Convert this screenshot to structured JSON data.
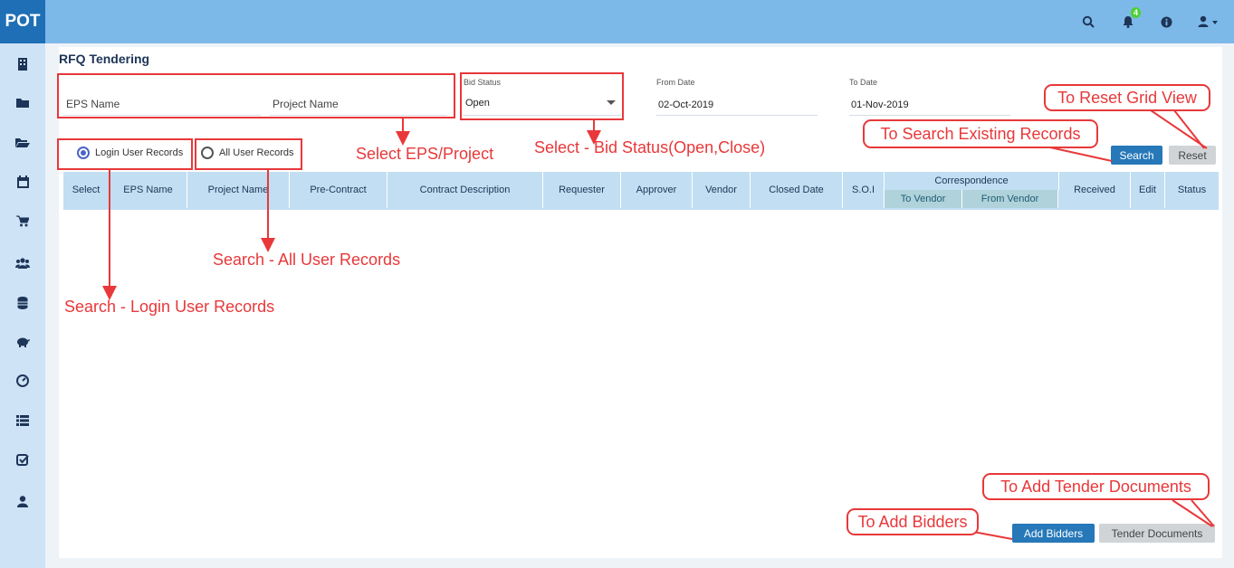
{
  "app": {
    "logo": "POT",
    "notification_count": "4"
  },
  "page": {
    "title": "RFQ Tendering"
  },
  "filters": {
    "eps_name_placeholder": "EPS Name",
    "project_name_placeholder": "Project Name",
    "bid_status_label": "Bid Status",
    "bid_status_value": "Open",
    "from_date_label": "From Date",
    "from_date_value": "02-Oct-2019",
    "to_date_label": "To Date",
    "to_date_value": "01-Nov-2019",
    "radio_login": "Login User Records",
    "radio_all": "All User Records",
    "search_label": "Search",
    "reset_label": "Reset"
  },
  "grid": {
    "headers": [
      "Select",
      "EPS Name",
      "Project Name",
      "Pre-Contract",
      "Contract Description",
      "Requester",
      "Approver",
      "Vendor",
      "Closed Date",
      "S.O.I",
      "Correspondence",
      "Received",
      "Edit",
      "Status"
    ],
    "sub_headers": [
      "To Vendor",
      "From Vendor"
    ]
  },
  "footer": {
    "add_bidders_label": "Add Bidders",
    "tender_documents_label": "Tender Documents"
  },
  "annotations": {
    "select_eps": "Select EPS/Project",
    "select_bid": "Select - Bid Status(Open,Close)",
    "search_all": "Search - All User Records",
    "search_login": "Search - Login User Records",
    "reset_grid": "To Reset Grid View",
    "search_existing": "To Search Existing Records",
    "add_tender_docs": "To Add Tender Documents",
    "add_bidders": "To Add Bidders"
  },
  "colors": {
    "topbar": "#7db9e8",
    "logo_bg": "#1e6fb5",
    "sidebar": "#cfe3f7",
    "primary_button": "#2778b8",
    "annotation": "#e8383a"
  },
  "icons": {
    "top": [
      "search-icon",
      "bell-icon",
      "info-icon",
      "user-icon"
    ],
    "sidebar": [
      "building-icon",
      "folder-icon",
      "folder-open-icon",
      "calendar-icon",
      "cart-icon",
      "users-icon",
      "database-icon",
      "piggy-bank-icon",
      "dashboard-icon",
      "list-icon",
      "checkbox-icon",
      "user-icon"
    ]
  }
}
